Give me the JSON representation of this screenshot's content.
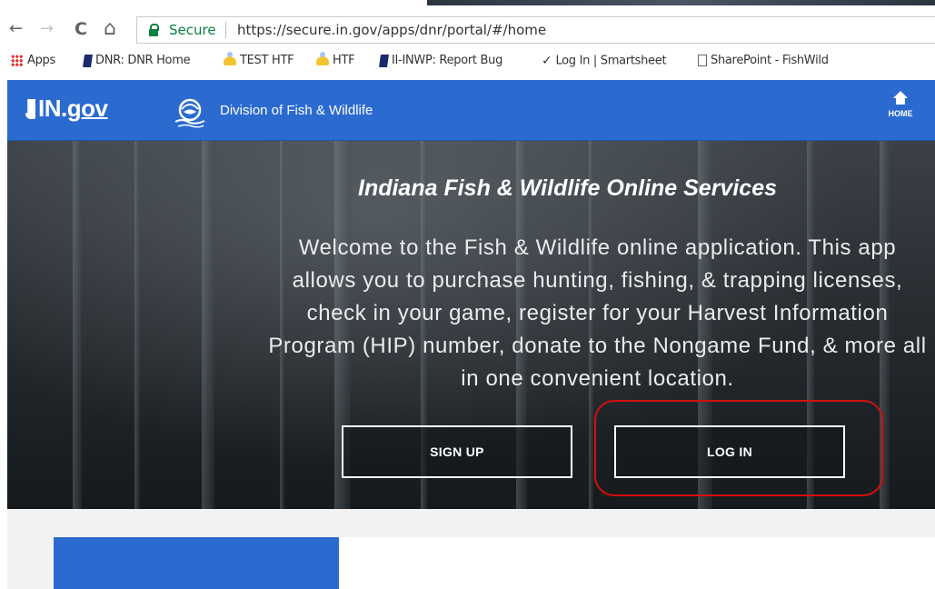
{
  "browser": {
    "nav": {
      "back": "←",
      "forward": "→",
      "reload": "C",
      "home": "⌂"
    },
    "address": {
      "secure_label": "Secure",
      "url": "https://secure.in.gov/apps/dnr/portal/#/home"
    },
    "bookmarks": [
      {
        "label": "Apps",
        "icon": "apps-grid-icon"
      },
      {
        "label": "DNR: DNR Home",
        "icon": "flag-icon"
      },
      {
        "label": "TEST HTF",
        "icon": "person-icon"
      },
      {
        "label": "HTF",
        "icon": "person-icon"
      },
      {
        "label": "II-INWP: Report Bug",
        "icon": "flag-icon"
      },
      {
        "label": "Log In | Smartsheet",
        "icon": "check-icon"
      },
      {
        "label": "SharePoint - FishWild",
        "icon": "document-icon"
      }
    ]
  },
  "site": {
    "brand_in": "IN",
    "brand_dot": ".",
    "brand_gov": "gov",
    "division": "Division of Fish & Wildlife",
    "home_label": "HOME",
    "colors": {
      "header_blue": "#2b6bd0",
      "highlight_red": "#d40f0f"
    }
  },
  "hero": {
    "title": "Indiana Fish & Wildlife Online Services",
    "text": "Welcome to the Fish & Wildlife online application. This app allows you to purchase hunting, fishing, & trapping licenses, check in your game, register for your Harvest Information Program (HIP) number, donate to the Nongame Fund, & more all in one convenient location.",
    "signup_label": "SIGN UP",
    "login_label": "LOG IN"
  }
}
